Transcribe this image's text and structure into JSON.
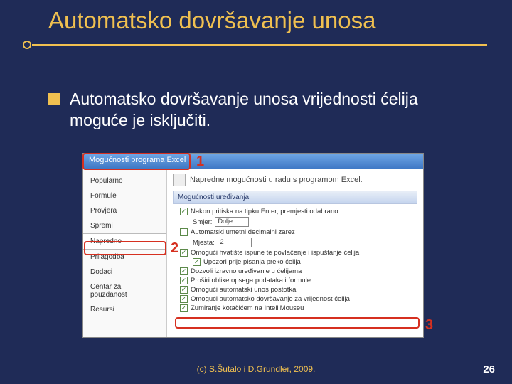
{
  "title": "Automatsko dovršavanje unosa",
  "bullet_text": "Automatsko dovršavanje unosa vrijednosti ćelija moguće je isključiti.",
  "dialog": {
    "title": "Mogućnosti programa Excel",
    "sidebar": [
      {
        "label": "Popularno"
      },
      {
        "label": "Formule"
      },
      {
        "label": "Provjera"
      },
      {
        "label": "Spremi"
      },
      {
        "label": "Napredno",
        "selected": true
      },
      {
        "label": "Prilagodba"
      },
      {
        "label": "Dodaci"
      },
      {
        "label": "Centar za pouzdanost"
      },
      {
        "label": "Resursi"
      }
    ],
    "right_head": "Napredne mogućnosti u radu s programom Excel.",
    "section_title": "Mogućnosti uređivanja",
    "smjer_label": "Smjer:",
    "smjer_value": "Dolje",
    "mjesta_label": "Mjesta:",
    "mjesta_value": "2",
    "options": [
      {
        "checked": true,
        "label": "Nakon pritiska na tipku Enter, premjesti odabrano"
      },
      {
        "checked": false,
        "label": "Automatski umetni decimalni zarez"
      },
      {
        "checked": true,
        "label": "Omogući hvatište ispune te povlačenje i ispuštanje ćelija"
      },
      {
        "checked": true,
        "label": "Upozori prije pisanja preko ćelija",
        "indent": true
      },
      {
        "checked": true,
        "label": "Dozvoli izravno uređivanje u ćelijama"
      },
      {
        "checked": true,
        "label": "Proširi oblike opsega podataka i formule"
      },
      {
        "checked": true,
        "label": "Omogući automatski unos postotka"
      },
      {
        "checked": true,
        "label": "Omogući automatsko dovršavanje za vrijednost ćelija"
      },
      {
        "checked": true,
        "label": "Zumiranje kotačićem na IntelliMouseu"
      }
    ]
  },
  "callouts": {
    "one": "1",
    "two": "2",
    "three": "3"
  },
  "copyright": "(c) S.Šutalo i D.Grundler, 2009.",
  "page_number": "26"
}
